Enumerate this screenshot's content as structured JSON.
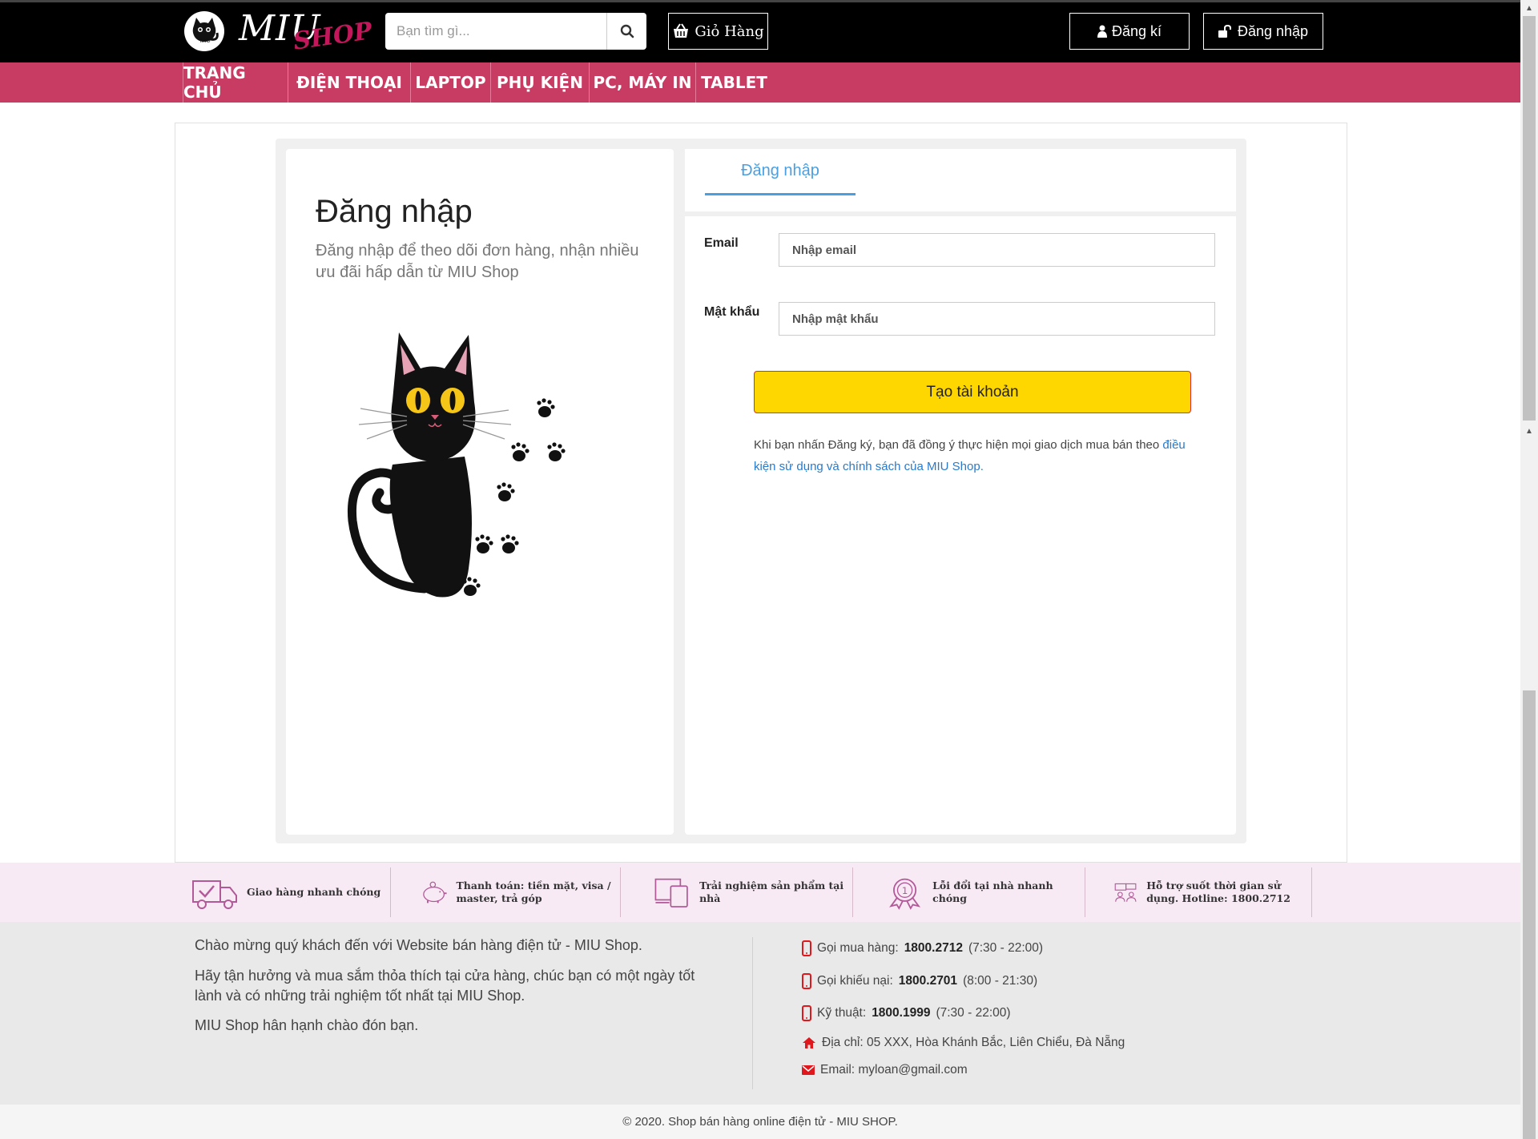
{
  "header": {
    "logo_main": "MIU",
    "logo_sub": "SHOP",
    "logo_badge": "MIU",
    "search_placeholder": "Bạn tìm gì...",
    "cart_label": "Giỏ Hàng",
    "register_label": "Đăng kí",
    "login_label": "Đăng nhập"
  },
  "nav": {
    "items": [
      {
        "label": "TRANG CHỦ"
      },
      {
        "label": "ĐIỆN THOẠI"
      },
      {
        "label": "LAPTOP"
      },
      {
        "label": "PHỤ KIỆN"
      },
      {
        "label": "PC, MÁY IN"
      },
      {
        "label": "TABLET"
      }
    ]
  },
  "login_page": {
    "title": "Đăng nhập",
    "description": "Đăng nhập để theo dõi đơn hàng, nhận nhiều ưu đãi hấp dẫn từ MIU Shop",
    "tab_label": "Đăng nhập",
    "form": {
      "email_label": "Email",
      "email_placeholder": "Nhập email",
      "password_label": "Mật khẩu",
      "password_placeholder": "Nhập mật khẩu",
      "submit_label": "Tạo tài khoản"
    },
    "terms_text": "Khi bạn nhấn Đăng ký, bạn đã đồng ý thực hiện mọi giao dịch mua bán theo ",
    "terms_link": "điều kiện sử dụng và chính sách của MIU Shop."
  },
  "features": [
    {
      "text": "Giao hàng nhanh chóng",
      "icon": "truck-icon"
    },
    {
      "text": "Thanh toán: tiền mặt, visa / master, trả góp",
      "icon": "piggy-bank-icon"
    },
    {
      "text": "Trải nghiệm sản phẩm tại nhà",
      "icon": "devices-icon"
    },
    {
      "text": "Lỗi đổi tại nhà nhanh chóng",
      "icon": "badge-icon"
    },
    {
      "text": "Hỗ trợ suốt thời gian sử dụng. Hotline: 1800.2712",
      "icon": "support-icon"
    }
  ],
  "footer": {
    "welcome": "Chào mừng quý khách đến với Website bán hàng điện tử - MIU Shop.",
    "enjoy": "Hãy tận hưởng và mua sắm thỏa thích tại cửa hàng, chúc bạn có một ngày tốt lành và có những trải nghiệm tốt nhất tại MIU Shop.",
    "greeting": "MIU Shop hân hạnh chào đón bạn.",
    "contacts": {
      "buy_label": "Gọi mua hàng:",
      "buy_phone": "1800.2712",
      "buy_hours": "(7:30 - 22:00)",
      "complain_label": "Gọi khiếu nại:",
      "complain_phone": "1800.2701",
      "complain_hours": "(8:00 - 21:30)",
      "tech_label": "Kỹ thuật:",
      "tech_phone": "1800.1999",
      "tech_hours": "(7:30 - 22:00)",
      "address": "Địa chỉ: 05 XXX, Hòa Khánh Bắc, Liên Chiểu, Đà Nẵng",
      "email": "Email: myloan@gmail.com"
    },
    "copyright": "© 2020. Shop bán hàng online điện tử - MIU SHOP."
  },
  "colors": {
    "nav_bg": "#c83b63",
    "accent_blue": "#4a9fe0",
    "button_yellow": "#ffd700",
    "footer_strip": "#f8eaf5",
    "icon_red": "#e0171c"
  }
}
